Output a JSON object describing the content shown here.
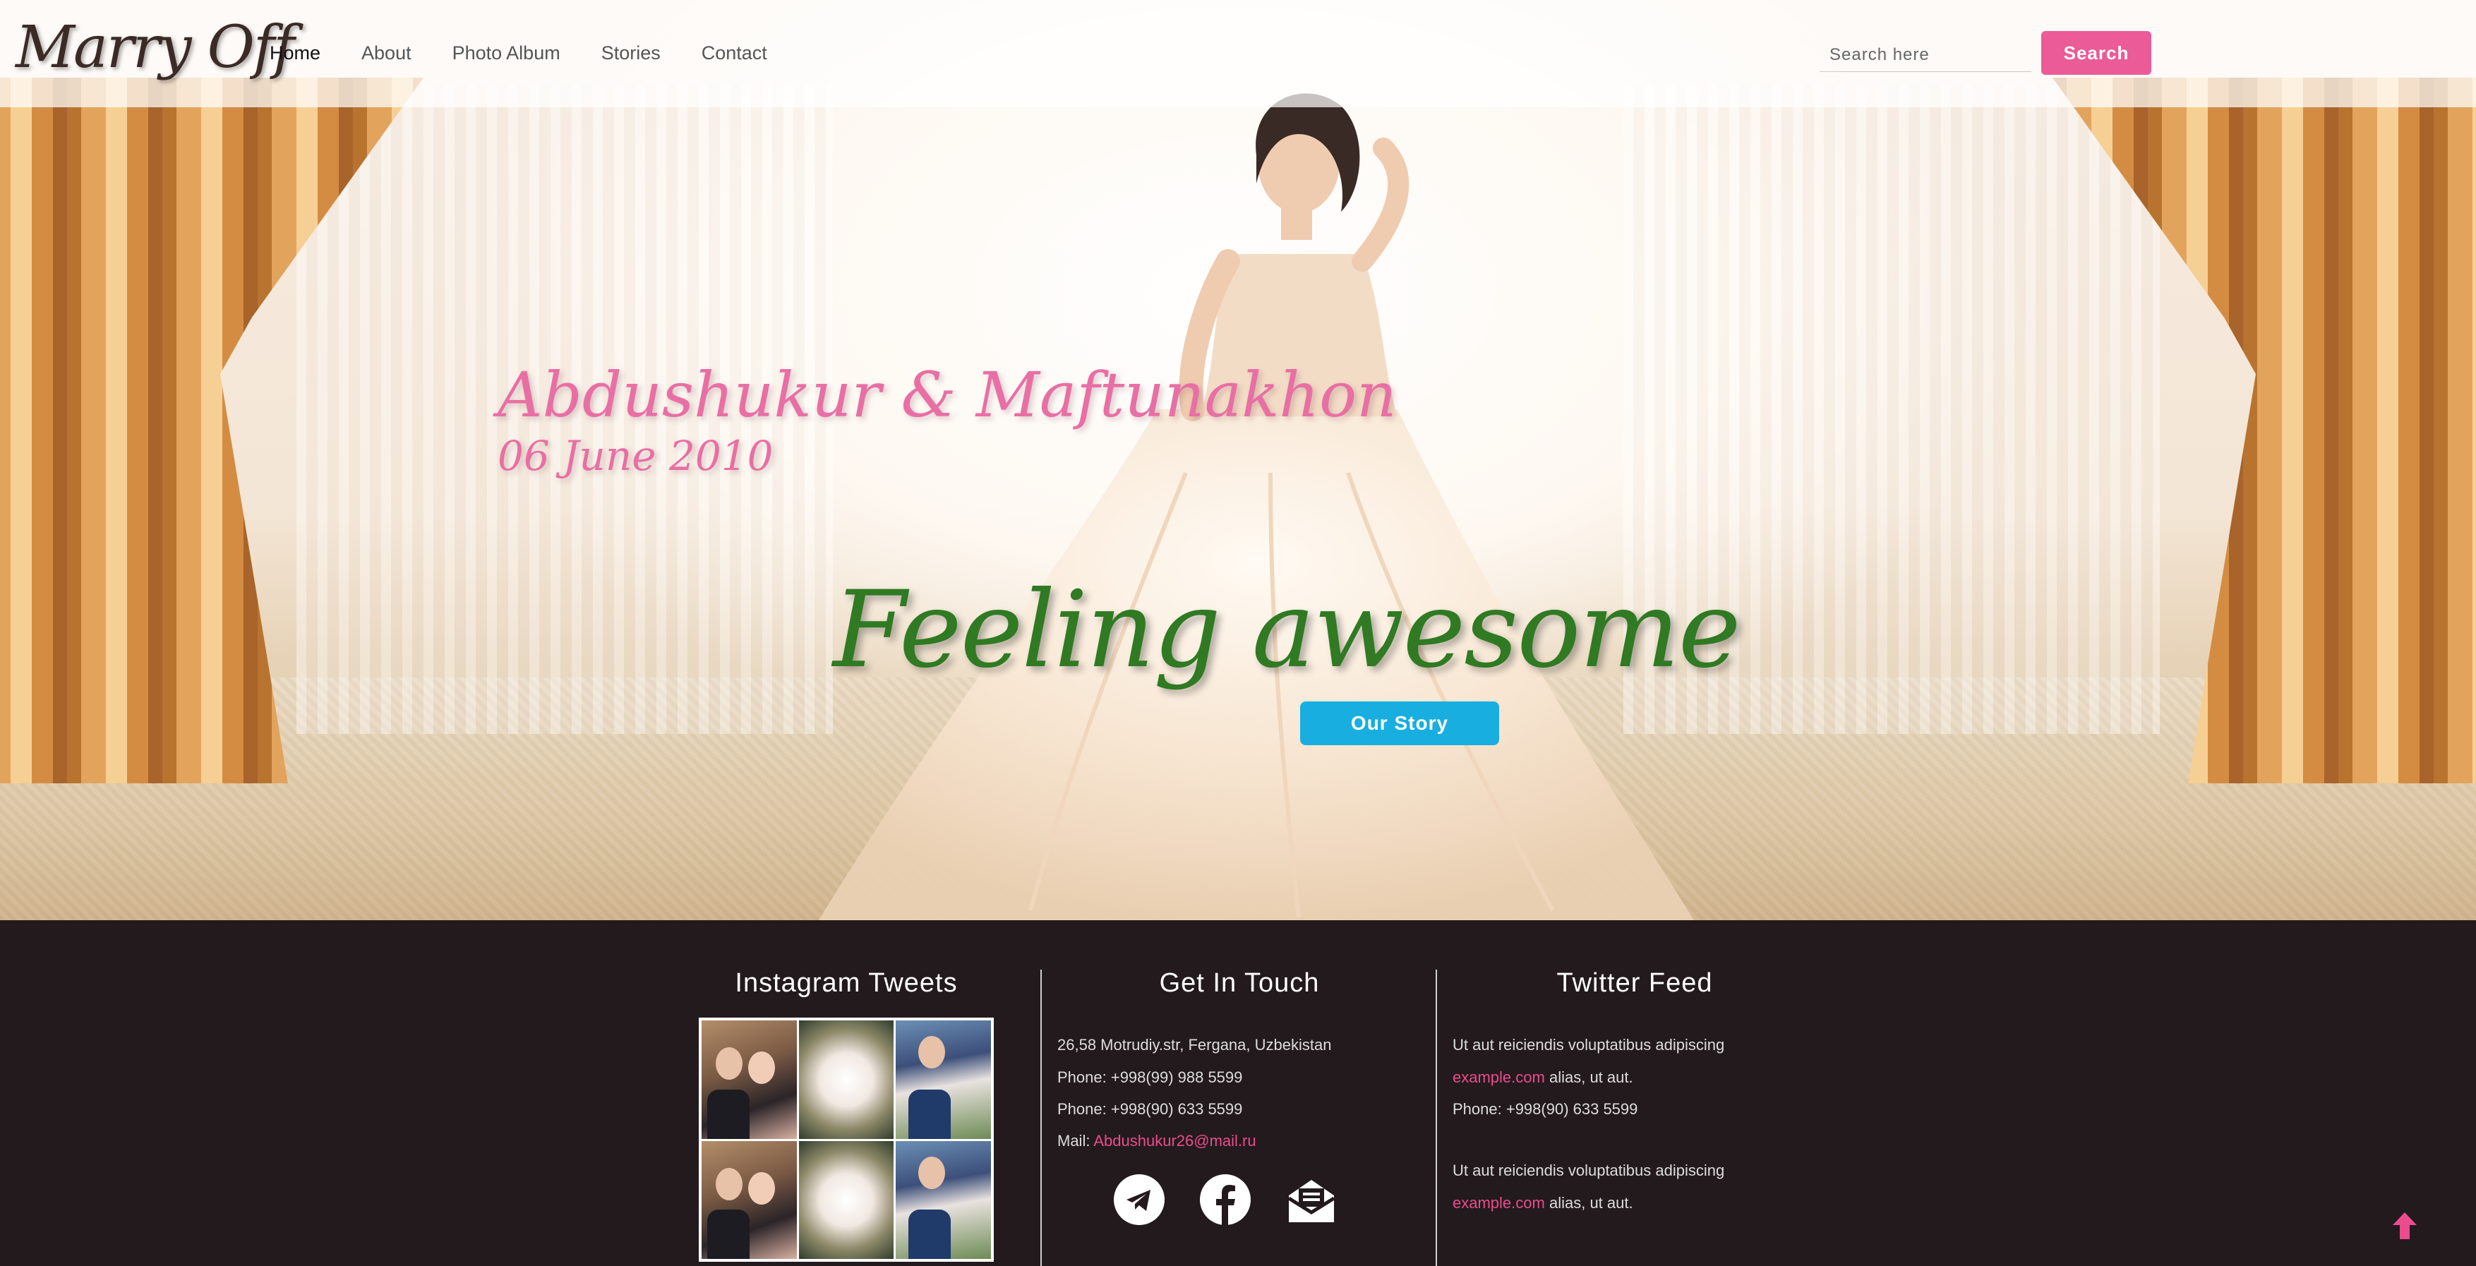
{
  "brand": {
    "logo_text": "Marry Off"
  },
  "nav": {
    "items": [
      {
        "label": "Home",
        "active": true
      },
      {
        "label": "About",
        "active": false
      },
      {
        "label": "Photo Album",
        "active": false
      },
      {
        "label": "Stories",
        "active": false
      },
      {
        "label": "Contact",
        "active": false
      }
    ]
  },
  "search": {
    "placeholder": "Search here",
    "button_label": "Search"
  },
  "hero": {
    "couple_names": "Abdushukur & Maftunakhon",
    "date": "06 June 2010",
    "tagline": "Feeling awesome",
    "cta_label": "Our Story"
  },
  "footer": {
    "instagram": {
      "title": "Instagram Tweets"
    },
    "contact": {
      "title": "Get In Touch",
      "address": "26,58 Motrudiy.str, Fergana, Uzbekistan",
      "phone1": "Phone: +998(99) 988 5599",
      "phone2": "Phone: +998(90) 633 5599",
      "mail_label": "Mail:",
      "mail_value": "Abdushukur26@mail.ru"
    },
    "twitter": {
      "title": "Twitter Feed",
      "line1": "Ut aut reiciendis voluptatibus adipiscing",
      "link1": "example.com",
      "line1_tail": "alias, ut aut.",
      "phone": "Phone: +998(90) 633 5599",
      "line2": "Ut aut reiciendis voluptatibus adipiscing",
      "link2": "example.com",
      "line2_tail": "alias, ut aut."
    }
  },
  "colors": {
    "accent_pink": "#ea5b97",
    "cta_blue": "#18aee0",
    "tagline_green": "#2f7a22",
    "footer_bg": "#231a1e"
  },
  "icons": [
    "telegram-icon",
    "facebook-icon",
    "mail-icon",
    "arrow-up-icon"
  ]
}
